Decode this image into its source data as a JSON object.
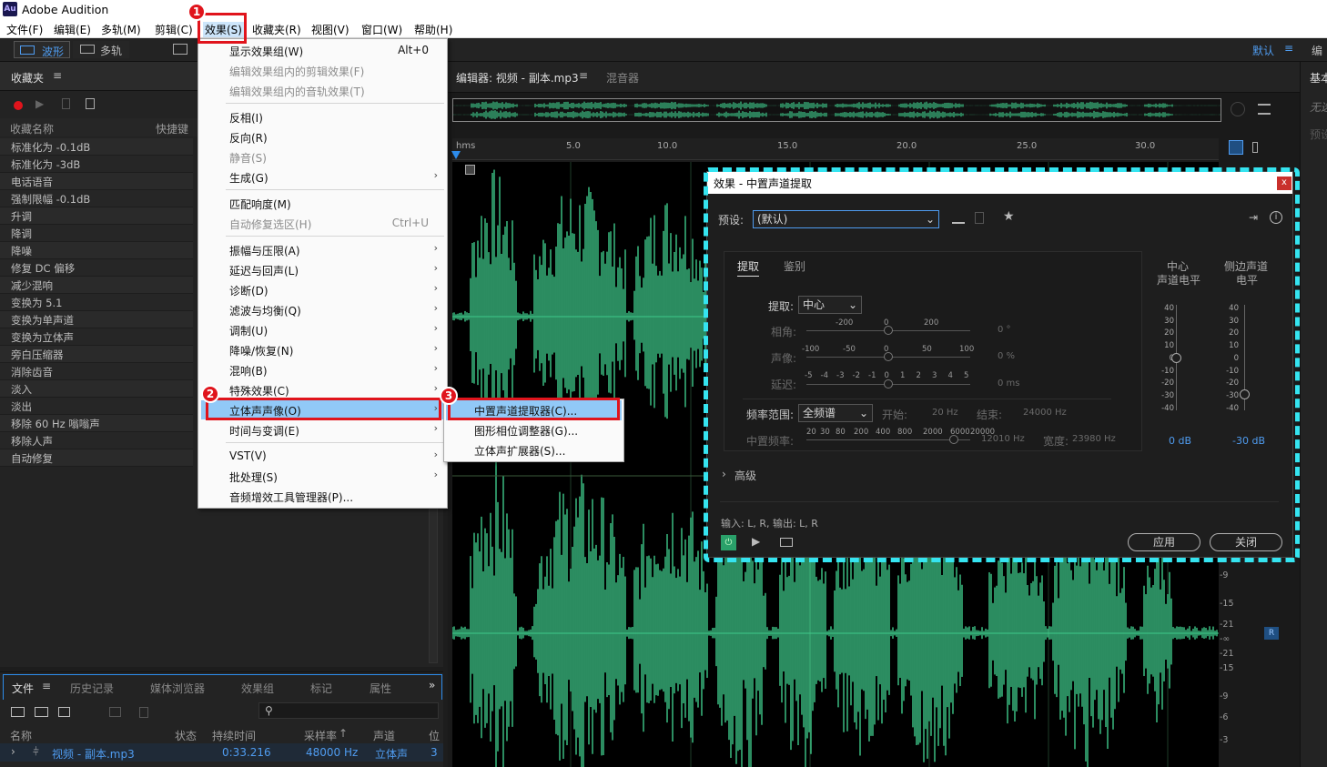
{
  "app": {
    "icon_label": "Au",
    "title": "Adobe Audition"
  },
  "menubar": [
    "文件(F)",
    "编辑(E)",
    "多轨(M)",
    "剪辑(C)",
    "效果(S)",
    "收藏夹(R)",
    "视图(V)",
    "窗口(W)",
    "帮助(H)"
  ],
  "toolbar": {
    "waveform": "波形",
    "multitrack": "多轨",
    "workspace": "默认",
    "right_cut": "编"
  },
  "favorites": {
    "title": "收藏夹",
    "col_name": "收藏名称",
    "col_shortcut": "快捷键",
    "items": [
      "标准化为 -0.1dB",
      "标准化为 -3dB",
      "电话语音",
      "强制限幅 -0.1dB",
      "升调",
      "降调",
      "降噪",
      "修复 DC 偏移",
      "减少混响",
      "变换为 5.1",
      "变换为单声道",
      "变换为立体声",
      "旁白压缩器",
      "消除齿音",
      "淡入",
      "淡出",
      "移除 60 Hz 嗡嗡声",
      "移除人声",
      "自动修复"
    ]
  },
  "effects_menu": [
    {
      "label": "显示效果组(W)",
      "shortcut": "Alt+0",
      "disabled": false,
      "sub": false
    },
    {
      "label": "编辑效果组内的剪辑效果(F)",
      "disabled": true,
      "sub": false
    },
    {
      "label": "编辑效果组内的音轨效果(T)",
      "disabled": true,
      "sub": false
    },
    {
      "label": "反相(I)",
      "disabled": false,
      "sub": false
    },
    {
      "label": "反向(R)",
      "disabled": false,
      "sub": false
    },
    {
      "label": "静音(S)",
      "disabled": true,
      "sub": false
    },
    {
      "label": "生成(G)",
      "disabled": false,
      "sub": true
    },
    {
      "label": "匹配响度(M)",
      "disabled": false,
      "sub": false
    },
    {
      "label": "自动修复选区(H)",
      "shortcut": "Ctrl+U",
      "disabled": true,
      "sub": false
    },
    {
      "label": "振幅与压限(A)",
      "disabled": false,
      "sub": true
    },
    {
      "label": "延迟与回声(L)",
      "disabled": false,
      "sub": true
    },
    {
      "label": "诊断(D)",
      "disabled": false,
      "sub": true
    },
    {
      "label": "滤波与均衡(Q)",
      "disabled": false,
      "sub": true
    },
    {
      "label": "调制(U)",
      "disabled": false,
      "sub": true
    },
    {
      "label": "降噪/恢复(N)",
      "disabled": false,
      "sub": true
    },
    {
      "label": "混响(B)",
      "disabled": false,
      "sub": true
    },
    {
      "label": "特殊效果(C)",
      "disabled": false,
      "sub": true
    },
    {
      "label": "立体声声像(O)",
      "disabled": false,
      "sub": true
    },
    {
      "label": "时间与变调(E)",
      "disabled": false,
      "sub": true
    },
    {
      "label": "VST(V)",
      "disabled": false,
      "sub": true
    },
    {
      "label": "批处理(S)",
      "disabled": false,
      "sub": true
    },
    {
      "label": "音频增效工具管理器(P)...",
      "disabled": false,
      "sub": false
    }
  ],
  "stereo_submenu": [
    "中置声道提取器(C)...",
    "图形相位调整器(G)...",
    "立体声扩展器(S)..."
  ],
  "badges": [
    "1",
    "2",
    "3"
  ],
  "editor": {
    "tab_editor": "编辑器: 视频 - 副本.mp3",
    "tab_mixer": "混音器",
    "ruler": [
      "hms",
      "5.0",
      "10.0",
      "15.0",
      "20.0",
      "25.0",
      "30.0"
    ],
    "db_scale": [
      "-9",
      "-15",
      "-21",
      "-∞",
      "-21",
      "-15",
      "-9",
      "-6",
      "-3"
    ],
    "channel_r": "R"
  },
  "right_panel": {
    "title": "基本",
    "item1": "无选",
    "item2": "预设"
  },
  "dialog": {
    "title": "效果 - 中置声道提取",
    "close": "x",
    "preset_label": "预设:",
    "preset_value": "(默认)",
    "tab_extract": "提取",
    "tab_identify": "鉴别",
    "extract_label": "提取:",
    "extract_value": "中心",
    "phase_label": "相角:",
    "phase_ticks": [
      "-200",
      "0",
      "200"
    ],
    "phase_value": "0 °",
    "pan_label": "声像:",
    "pan_ticks": [
      "-100",
      "-50",
      "0",
      "50",
      "100"
    ],
    "pan_value": "0 %",
    "delay_label": "延迟:",
    "delay_ticks": [
      "-5",
      "-4",
      "-3",
      "-2",
      "-1",
      "0",
      "1",
      "2",
      "3",
      "4",
      "5"
    ],
    "delay_value": "0 ms",
    "freq_range_label": "频率范围:",
    "freq_range_value": "全频谱",
    "start_label": "开始:",
    "start_value": "20 Hz",
    "end_label": "结束:",
    "end_value": "24000 Hz",
    "center_freq_label": "中置频率:",
    "center_freq_ticks": [
      "20",
      "30",
      "80",
      "200",
      "400",
      "800",
      "2000",
      "6000",
      "20000"
    ],
    "center_freq_value": "12010 Hz",
    "width_label": "宽度:",
    "width_value": "23980 Hz",
    "center_level_title1": "中心",
    "center_level_title2": "声道电平",
    "side_level_title1": "侧边声道",
    "side_level_title2": "电平",
    "level_scale": [
      "40",
      "30",
      "20",
      "10",
      "0",
      "-10",
      "-20",
      "-30",
      "-40"
    ],
    "center_level_value": "0 dB",
    "side_level_value": "-30 dB",
    "advanced": "高级",
    "io": "输入: L, R,  输出: L, R",
    "apply": "应用",
    "close_btn": "关闭"
  },
  "files": {
    "tabs": [
      "文件",
      "历史记录",
      "媒体浏览器",
      "效果组",
      "标记",
      "属性"
    ],
    "cols": [
      "名称",
      "状态",
      "持续时间",
      "采样率",
      "声道",
      "位"
    ],
    "row": {
      "name": "视频 - 副本.mp3",
      "duration": "0:33.216",
      "rate": "48000 Hz",
      "channels": "立体声",
      "bits": "3"
    }
  },
  "colors": {
    "wave": "#3ec98a",
    "accent": "#2d8ceb",
    "highlight_border": "#e0141c",
    "dialog_outline": "#35e4f0",
    "menu_highlight": "#91c9f7"
  }
}
